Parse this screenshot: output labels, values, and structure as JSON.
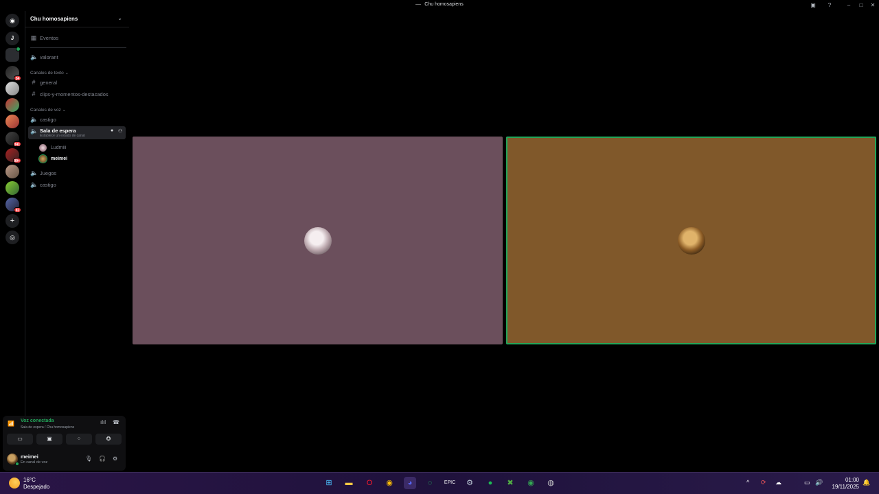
{
  "window": {
    "title": "Chu homosapiens"
  },
  "server": {
    "name": "Chu homosapiens"
  },
  "channels": {
    "events": "Eventos",
    "top_voice": "valorant",
    "text_category": "Canales de texto",
    "text": [
      "general",
      "clips-y-momentos-destacados"
    ],
    "voice_category": "Canales de voz",
    "voice_first": "castigo",
    "active_voice": {
      "name": "Sala de espera",
      "status": "Establece un estado de canal"
    },
    "voice_users": [
      "Ludmiii",
      "meimei"
    ],
    "voice_rest": [
      "Juegos",
      "castigo"
    ]
  },
  "rail": {
    "home_letter": "J",
    "badges": [
      "34",
      "341",
      "99+",
      "81"
    ]
  },
  "voice_panel": {
    "status": "Voz conectada",
    "location": "Sala de espera / Chu homosapiens"
  },
  "user": {
    "name": "meimei",
    "status": "En canal de voz"
  },
  "taskbar": {
    "weather_temp": "16°C",
    "weather_desc": "Despejado",
    "time": "01:00",
    "date": "19/11/2025"
  },
  "colors": {
    "tile1": "#6b4f5c",
    "tile2": "#80582a",
    "speaking": "#23a55a",
    "badge": "#f23f43"
  }
}
